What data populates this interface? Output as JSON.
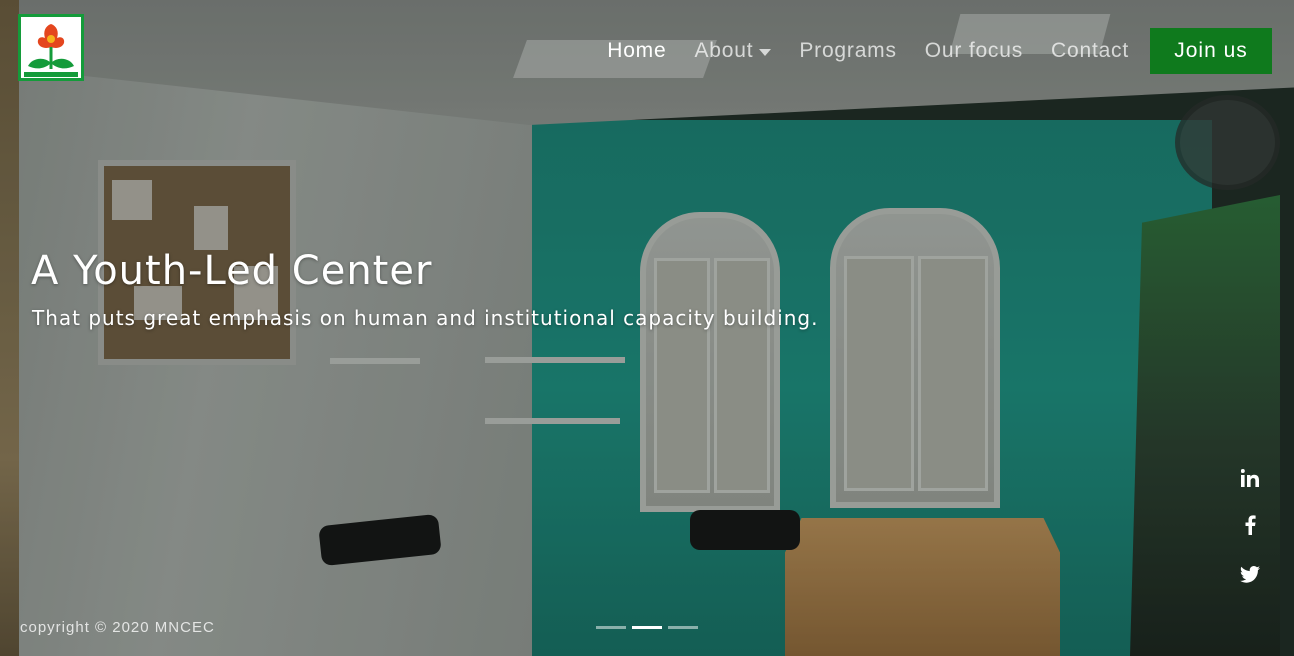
{
  "header": {
    "nav": [
      {
        "label": "Home",
        "active": true
      },
      {
        "label": "About",
        "dropdown": true
      },
      {
        "label": "Programs"
      },
      {
        "label": "Our focus"
      },
      {
        "label": "Contact"
      }
    ],
    "cta_label": "Join us"
  },
  "hero": {
    "title": "A Youth-Led Center",
    "subtitle": "That puts great emphasis on human and institutional capacity building.",
    "slides_total": 3,
    "active_slide": 2
  },
  "social": [
    "linkedin-icon",
    "facebook-icon",
    "twitter-icon"
  ],
  "footer": {
    "copyright": "copyright © 2020 MNCEC"
  },
  "colors": {
    "cta_green": "#0f7a1d",
    "logo_green": "#149b3a",
    "logo_flower": "#e4461e"
  }
}
